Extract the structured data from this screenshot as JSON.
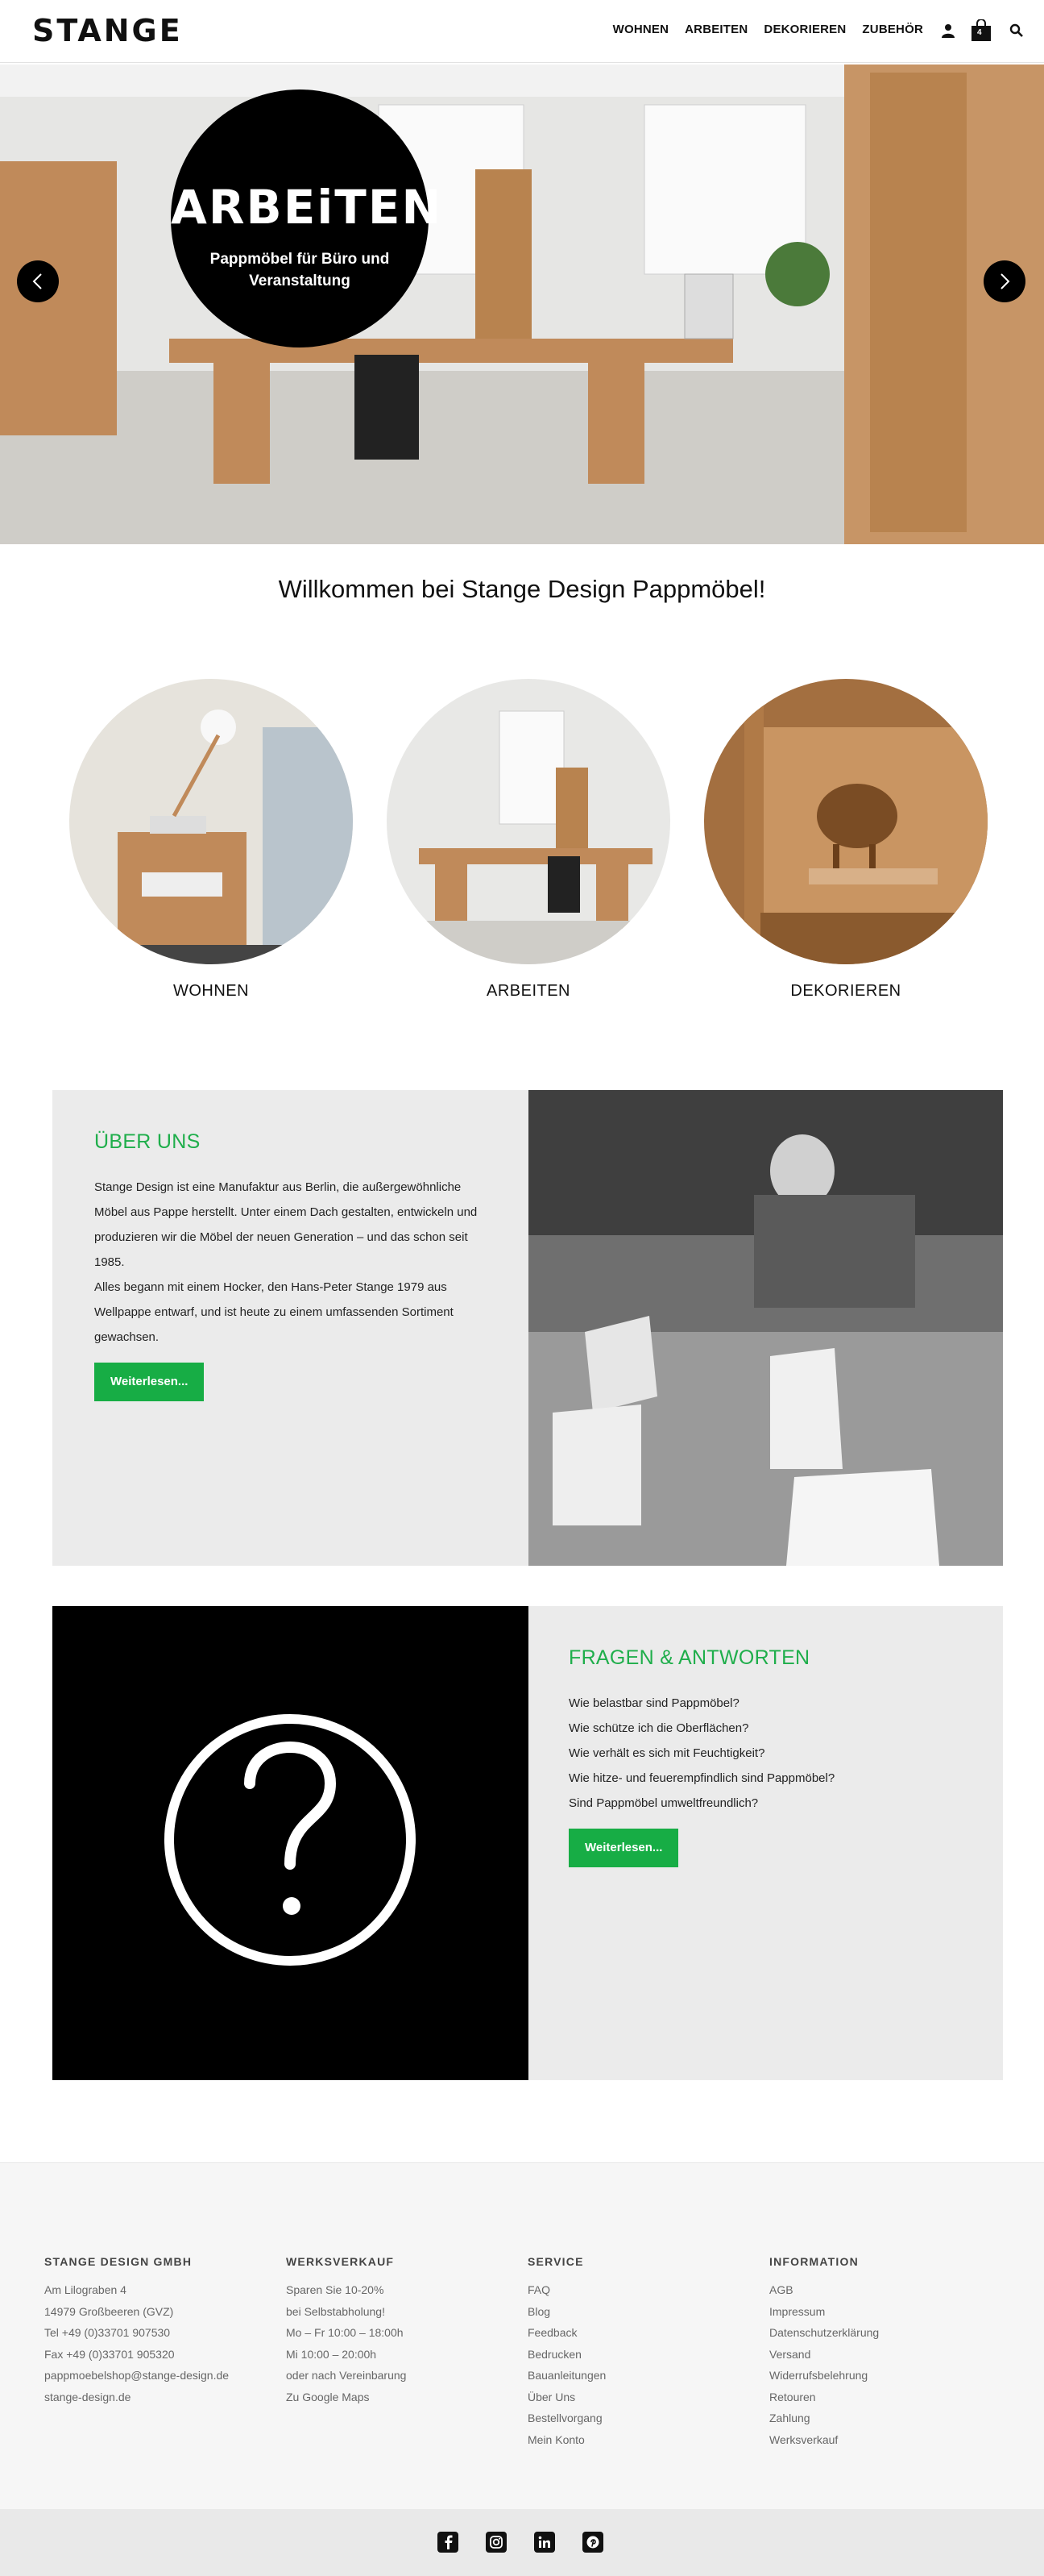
{
  "brand": {
    "logo_text": "STANGE"
  },
  "nav": {
    "items": [
      "WOHNEN",
      "ARBEITEN",
      "DEKORIEREN",
      "ZUBEHÖR"
    ]
  },
  "cart": {
    "count": "4"
  },
  "icons": {
    "account": "user-icon",
    "cart": "bag-icon",
    "search": "search-icon",
    "prev": "chevron-left-icon",
    "next": "chevron-right-icon"
  },
  "hero": {
    "title": "ARBEiTEN",
    "subtitle": "Pappmöbel für Büro und Veranstaltung"
  },
  "welcome": "Willkommen bei Stange Design Pappmöbel!",
  "categories": [
    {
      "label": "WOHNEN"
    },
    {
      "label": "ARBEITEN"
    },
    {
      "label": "DEKORIEREN"
    }
  ],
  "about": {
    "title": "ÜBER UNS",
    "body": "Stange Design ist eine Manufaktur aus Berlin, die außergewöhnliche Möbel aus Pappe herstellt. Unter einem Dach gestalten, entwickeln und produzieren wir die Möbel der neuen Generation – und das schon seit 1985.",
    "body2": "Alles begann mit einem Hocker, den Hans-Peter Stange 1979 aus Wellpappe entwarf, und ist heute zu einem umfassenden Sortiment gewachsen.",
    "button": "Weiterlesen..."
  },
  "faq": {
    "title": "FRAGEN & ANTWORTEN",
    "questions": [
      "Wie belastbar sind Pappmöbel?",
      "Wie schütze ich die Oberflächen?",
      "Wie verhält es sich mit Feuchtigkeit?",
      "Wie hitze- und feuerempfindlich sind Pappmöbel?",
      "Sind Pappmöbel umweltfreundlich?"
    ],
    "button": "Weiterlesen..."
  },
  "footer": {
    "columns": [
      {
        "heading": "STANGE DESIGN GMBH",
        "lines": [
          "Am Lilograben 4",
          "14979 Großbeeren (GVZ)",
          "Tel +49 (0)33701 907530",
          "Fax +49 (0)33701 905320",
          "pappmoebelshop@stange-design.de",
          "stange-design.de"
        ]
      },
      {
        "heading": "WERKSVERKAUF",
        "lines": [
          "Sparen Sie 10-20%",
          "bei Selbstabholung!",
          "Mo – Fr 10:00 – 18:00h",
          "Mi 10:00 – 20:00h",
          "oder nach Vereinbarung",
          "Zu Google Maps"
        ]
      },
      {
        "heading": "SERVICE",
        "lines": [
          "FAQ",
          "Blog",
          "Feedback",
          "Bedrucken",
          "Bauanleitungen",
          "Über Uns",
          "Bestellvorgang",
          "Mein Konto"
        ]
      },
      {
        "heading": "INFORMATION",
        "lines": [
          "AGB",
          "Impressum",
          "Datenschutzerklärung",
          "Versand",
          "Widerrufsbelehrung",
          "Retouren",
          "Zahlung",
          "Werksverkauf"
        ]
      }
    ]
  },
  "social": [
    "facebook-icon",
    "instagram-icon",
    "linkedin-icon",
    "pinterest-icon"
  ],
  "colors": {
    "accent_green": "#17ad45",
    "title_green": "#1fae4b",
    "panel_gray": "#ebebeb",
    "footer_gray": "#f6f6f6"
  }
}
